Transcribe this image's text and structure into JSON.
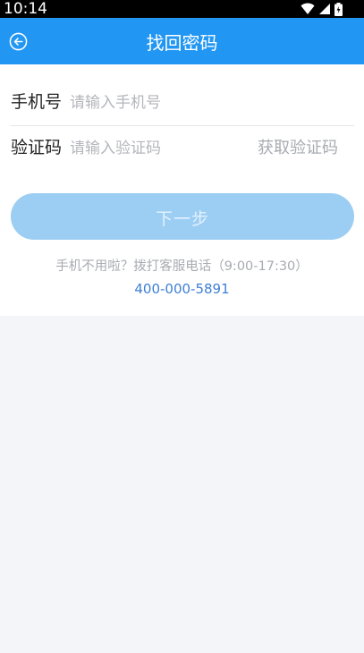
{
  "status_bar": {
    "time": "10:14",
    "icons": [
      "wifi-icon",
      "signal-icon",
      "battery-icon"
    ]
  },
  "app_bar": {
    "title": "找回密码",
    "back_icon": "back-arrow-icon",
    "color": "#2196f3"
  },
  "form": {
    "phone": {
      "label": "手机号",
      "placeholder": "请输入手机号",
      "value": ""
    },
    "code": {
      "label": "验证码",
      "placeholder": "请输入验证码",
      "value": "",
      "get_code_label": "获取验证码"
    },
    "next_button": {
      "label": "下一步",
      "color": "#9ccef3"
    }
  },
  "help": {
    "hint": "手机不用啦？拨打客服电话（9:00-17:30）",
    "hotline": "400-000-5891",
    "hotline_color": "#3d7fd6"
  }
}
